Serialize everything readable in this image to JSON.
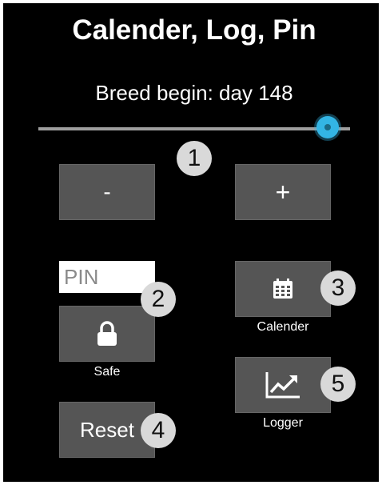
{
  "title": "Calender, Log, Pin",
  "slider": {
    "label": "Breed begin: day 148",
    "value_fraction": 0.94
  },
  "buttons": {
    "minus": "-",
    "plus": "+",
    "reset": "Reset"
  },
  "pin": {
    "placeholder": "PIN",
    "value": ""
  },
  "labels": {
    "safe": "Safe",
    "calender": "Calender",
    "logger": "Logger"
  },
  "icons": {
    "safe": "lock-icon",
    "calender": "calendar-icon",
    "logger": "chart-line-icon"
  },
  "callouts": [
    "1",
    "2",
    "3",
    "4",
    "5"
  ],
  "colors": {
    "background": "#000000",
    "accent": "#33b5e5",
    "button": "#555555",
    "callout": "#d9d9d9"
  }
}
